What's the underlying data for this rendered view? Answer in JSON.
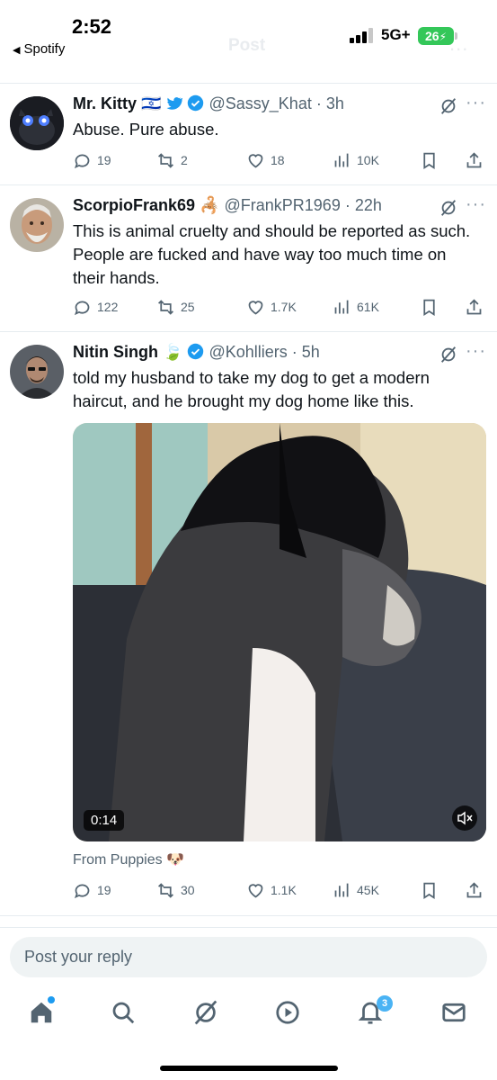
{
  "status_bar": {
    "time": "2:52",
    "back_app": "Spotify",
    "network": "5G+",
    "battery": "26",
    "faded_title": "Post",
    "faded_more": "..."
  },
  "tweets": [
    {
      "name": "Mr. Kitty",
      "name_badges": "🇮🇱",
      "handle": "@Sassy_Khat",
      "time": "3h",
      "text": "Abuse. Pure abuse.",
      "replies": "19",
      "reposts": "2",
      "likes": "18",
      "views": "10K"
    },
    {
      "name": "ScorpioFrank69",
      "name_badges": "🦂",
      "handle": "@FrankPR1969",
      "time": "22h",
      "text": "This is animal cruelty and should be reported as such. People are fucked and have way too much time on their hands.",
      "replies": "122",
      "reposts": "25",
      "likes": "1.7K",
      "views": "61K"
    },
    {
      "name": "Nitin Singh",
      "name_badges": "🍃",
      "handle": "@Kohlliers",
      "time": "5h",
      "text": "told my husband to take my dog to get a modern haircut, and he brought my dog home like this.",
      "video_duration": "0:14",
      "source": "From Puppies 🐶",
      "replies": "19",
      "reposts": "30",
      "likes": "1.1K",
      "views": "45K"
    }
  ],
  "reply_bar": {
    "placeholder": "Post your reply"
  },
  "nav": {
    "notification_count": "3",
    "icons": [
      "home-icon",
      "search-icon",
      "grok-icon",
      "video-icon",
      "notifications-icon",
      "messages-icon"
    ]
  },
  "colors": {
    "accent": "#1d9bf0",
    "text": "#0f1419",
    "secondary": "#536471",
    "battery": "#34c759"
  }
}
